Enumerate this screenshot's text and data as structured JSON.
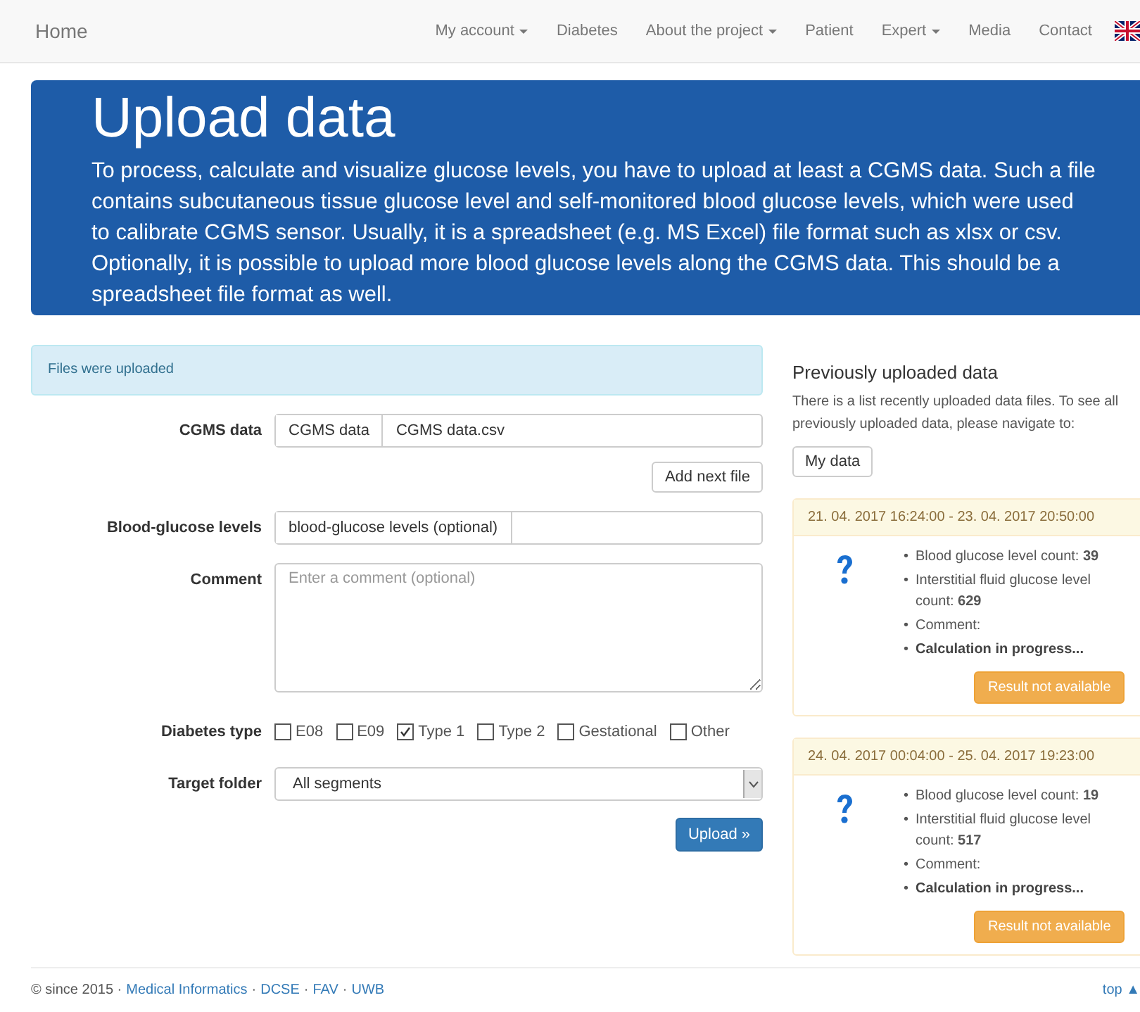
{
  "navbar": {
    "brand": "Home",
    "items": [
      {
        "label": "My account",
        "dropdown": true
      },
      {
        "label": "Diabetes",
        "dropdown": false
      },
      {
        "label": "About the project",
        "dropdown": true
      },
      {
        "label": "Patient",
        "dropdown": false
      },
      {
        "label": "Expert",
        "dropdown": true
      },
      {
        "label": "Media",
        "dropdown": false
      },
      {
        "label": "Contact",
        "dropdown": false
      }
    ]
  },
  "jumbotron": {
    "title": "Upload data",
    "text": "To process, calculate and visualize glucose levels, you have to upload at least a CGMS data. Such a file contains subcutaneous tissue glucose level and self-monitored blood glucose levels, which were used to calibrate CGMS sensor. Usually, it is a spreadsheet (e.g. MS Excel) file format such as xlsx or csv. Optionally, it is possible to upload more blood glucose levels along the CGMS data. This should be a spreadsheet file format as well."
  },
  "alert": "Files were uploaded",
  "form": {
    "cgms": {
      "label": "CGMS data",
      "button": "CGMS data",
      "value": "CGMS data.csv"
    },
    "add_next": "Add next file",
    "blood": {
      "label": "Blood-glucose levels",
      "button": "blood-glucose levels (optional)"
    },
    "comment": {
      "label": "Comment",
      "placeholder": "Enter a comment (optional)"
    },
    "diabetes_type": {
      "label": "Diabetes type",
      "options": [
        {
          "label": "E08",
          "checked": false
        },
        {
          "label": "E09",
          "checked": false
        },
        {
          "label": "Type 1",
          "checked": true
        },
        {
          "label": "Type 2",
          "checked": false
        },
        {
          "label": "Gestational",
          "checked": false
        },
        {
          "label": "Other",
          "checked": false
        }
      ]
    },
    "target_folder": {
      "label": "Target folder",
      "value": "All segments"
    },
    "submit": "Upload »"
  },
  "previous": {
    "title": "Previously uploaded data",
    "text": "There is a list recently uploaded data files. To see all previously uploaded data, please navigate to:",
    "button": "My data",
    "cards": [
      {
        "range": "21. 04. 2017 16:24:00 - 23. 04. 2017 20:50:00",
        "items": [
          {
            "bullet": "•",
            "text": "Blood glucose level count: **39**"
          },
          {
            "bullet": "•",
            "text": "Interstitial fluid glucose level count: **629**"
          },
          {
            "bullet": "•",
            "text": "Comment:"
          }
        ],
        "status": {
          "bullet": "•",
          "text": "Calculation in progress..."
        },
        "button": "Result not available"
      },
      {
        "range": "24. 04. 2017 00:04:00 - 25. 04. 2017 19:23:00",
        "items": [
          {
            "bullet": "•",
            "text": "Blood glucose level count: **19**"
          },
          {
            "bullet": "•",
            "text": "Interstitial fluid glucose level count: **517**"
          },
          {
            "bullet": "•",
            "text": "Comment:"
          }
        ],
        "status": {
          "bullet": "•",
          "text": "Calculation in progress..."
        },
        "button": "Result not available"
      }
    ]
  },
  "footer": {
    "parts": [
      {
        "kind": "text",
        "text": "© since 2015 ·"
      },
      {
        "kind": "link",
        "text": "Medical Informatics"
      },
      {
        "kind": "text",
        "text": "·"
      },
      {
        "kind": "link",
        "text": "DCSE"
      },
      {
        "kind": "text",
        "text": "·"
      },
      {
        "kind": "link",
        "text": "FAV"
      },
      {
        "kind": "text",
        "text": "·"
      },
      {
        "kind": "link",
        "text": "UWB"
      }
    ],
    "top": "top ▲"
  }
}
